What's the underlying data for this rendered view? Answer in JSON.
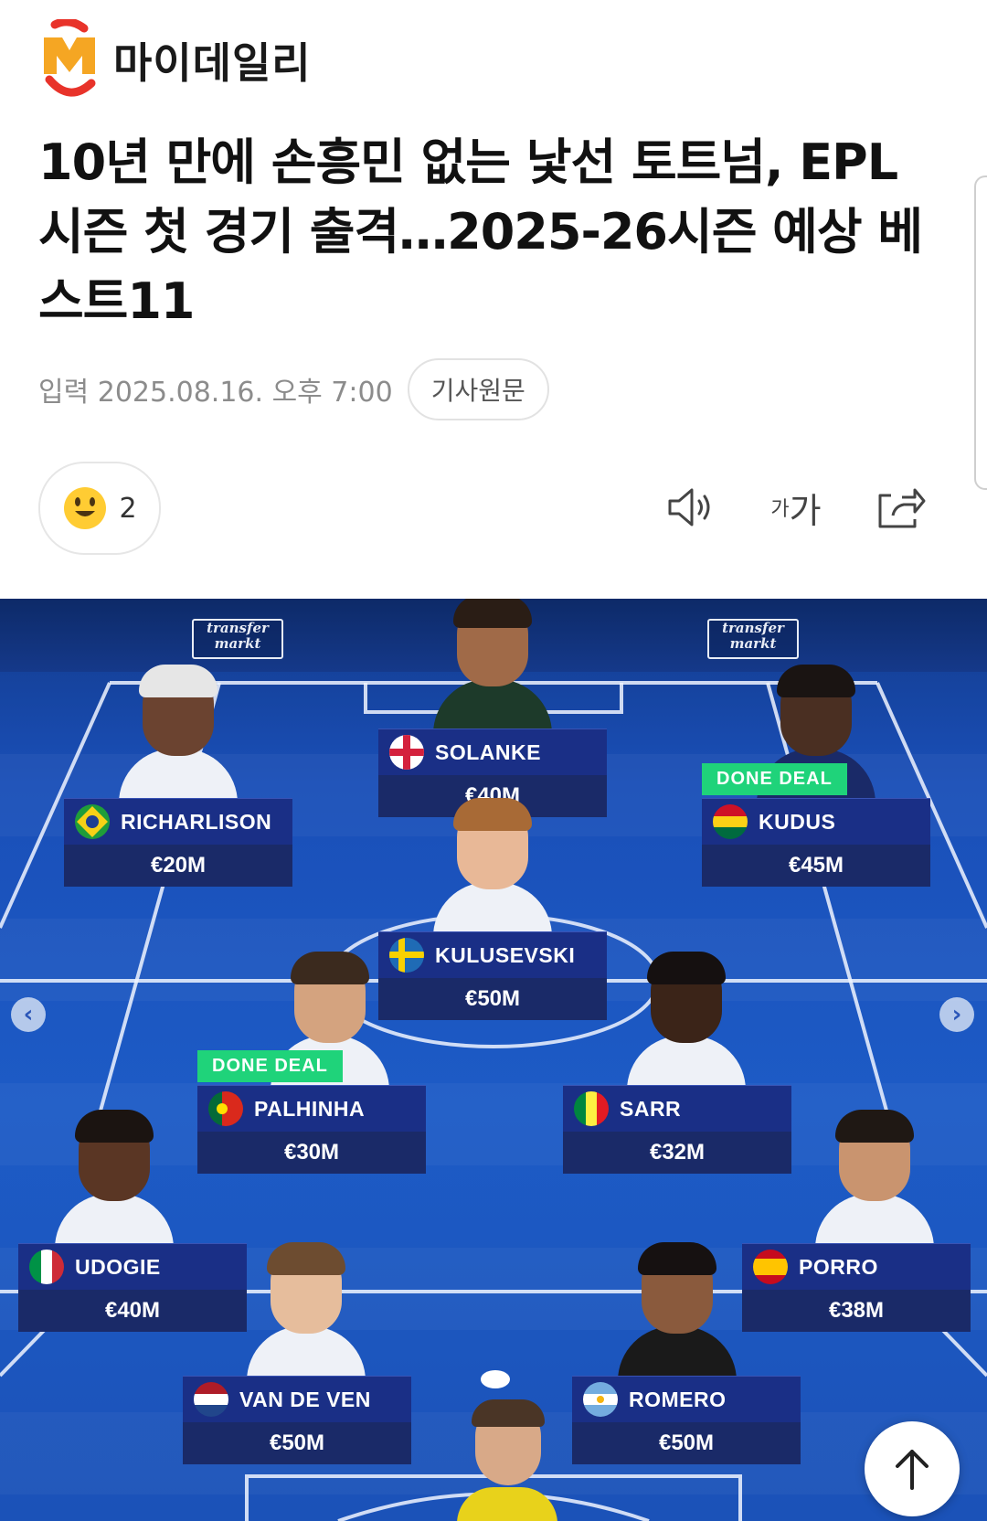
{
  "header": {
    "logo_text": "마이데일리"
  },
  "article": {
    "title": "10년 만에 손흥민 없는 낯선 토트넘, EPL 시즌 첫 경기 출격…2025-26시즌 예상 베스트11",
    "date": "입력 2025.08.16. 오후 7:00",
    "original_button": "기사원문"
  },
  "reaction": {
    "icon": "smiling-face-emoji",
    "count": "2"
  },
  "toolbar": {
    "tts_icon": "speaker-icon",
    "font_label_small": "가",
    "font_label_large": "가",
    "share_icon": "share-icon"
  },
  "image": {
    "watermark": "transfer markt",
    "players": [
      {
        "name": "SOLANKE",
        "value": "€40M",
        "flag": "england"
      },
      {
        "name": "RICHARLISON",
        "value": "€20M",
        "flag": "brazil"
      },
      {
        "name": "KUDUS",
        "value": "€45M",
        "flag": "ghana",
        "tag": "DONE DEAL"
      },
      {
        "name": "KULUSEVSKI",
        "value": "€50M",
        "flag": "sweden"
      },
      {
        "name": "PALHINHA",
        "value": "€30M",
        "flag": "portugal",
        "tag": "DONE DEAL"
      },
      {
        "name": "SARR",
        "value": "€32M",
        "flag": "senegal"
      },
      {
        "name": "UDOGIE",
        "value": "€40M",
        "flag": "italy"
      },
      {
        "name": "PORRO",
        "value": "€38M",
        "flag": "spain"
      },
      {
        "name": "VAN DE VEN",
        "value": "€50M",
        "flag": "netherlands"
      },
      {
        "name": "ROMERO",
        "value": "€50M",
        "flag": "argentina"
      }
    ]
  },
  "colors": {
    "accent_orange": "#f15a22",
    "deal_green": "#1fd37a",
    "card_blue": "#1a2f86"
  }
}
